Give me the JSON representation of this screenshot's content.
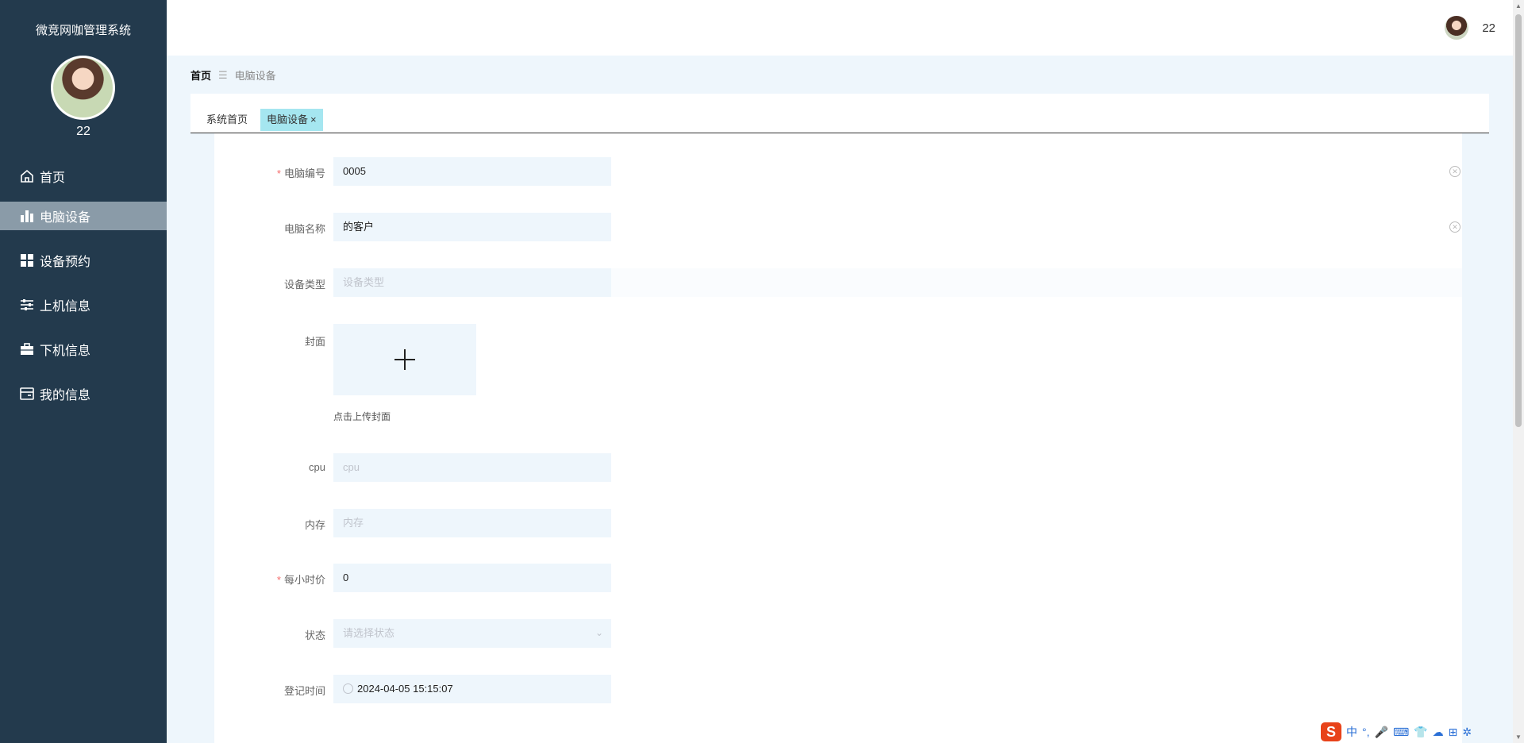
{
  "sidebar": {
    "title": "微竞网咖管理系统",
    "username": "22",
    "menu": [
      {
        "label": "首页",
        "icon": "home-icon"
      },
      {
        "label": "电脑设备",
        "icon": "bar-chart-icon"
      },
      {
        "label": "设备预约",
        "icon": "grid-icon"
      },
      {
        "label": "上机信息",
        "icon": "sliders-icon"
      },
      {
        "label": "下机信息",
        "icon": "briefcase-icon"
      },
      {
        "label": "我的信息",
        "icon": "card-icon"
      }
    ],
    "active_index": 1
  },
  "header": {
    "username": "22"
  },
  "breadcrumb": {
    "home": "首页",
    "separator": "☰",
    "current": "电脑设备"
  },
  "tabs": [
    {
      "label": "系统首页"
    },
    {
      "label": "电脑设备",
      "close": "×"
    }
  ],
  "form": {
    "computer_no": {
      "label": "电脑编号",
      "value": "0005",
      "required": "*"
    },
    "computer_name": {
      "label": "电脑名称",
      "value": "的客户"
    },
    "device_type": {
      "label": "设备类型",
      "placeholder": "设备类型"
    },
    "cover": {
      "label": "封面",
      "tip": "点击上传封面",
      "plus": "+"
    },
    "cpu": {
      "label": "cpu",
      "placeholder": "cpu"
    },
    "memory": {
      "label": "内存",
      "placeholder": "内存"
    },
    "hourly_price": {
      "label": "每小时价",
      "value": "0",
      "required": "*"
    },
    "status": {
      "label": "状态",
      "placeholder": "请选择状态"
    },
    "register_time": {
      "label": "登记时间",
      "value": "2024-04-05 15:15:07"
    }
  },
  "ime": {
    "logo": "S",
    "lang": "中",
    "items": [
      "°,",
      "🎤",
      "⌨",
      "👕",
      "☁",
      "⊞",
      "✲"
    ]
  }
}
